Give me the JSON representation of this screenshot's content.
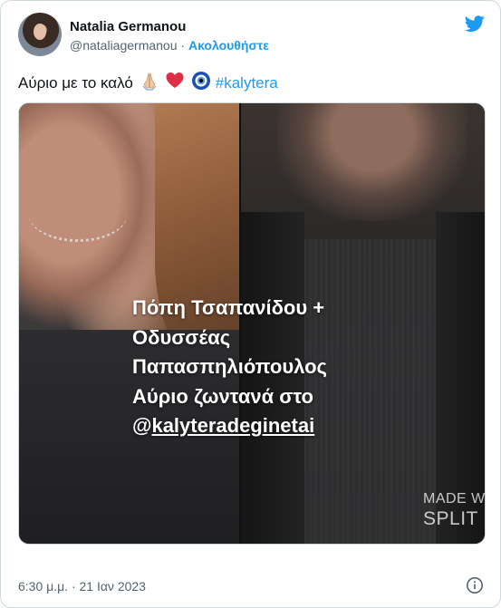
{
  "user": {
    "name": "Natalia Germanou",
    "handle": "@nataliagermanou",
    "separator": "·",
    "follow_label": "Ακολουθήστε"
  },
  "tweet": {
    "text": "Αύριο με το καλό",
    "emojis": [
      "folded-hands-icon",
      "red-heart-icon",
      "nazar-amulet-icon"
    ],
    "hashtag": "#kalytera"
  },
  "media": {
    "overlay_lines": [
      "Πόπη Τσαπανίδου +",
      "Οδυσσέας",
      "Παπασπηλιόπουλος",
      "Αύριο ζωντανά στο"
    ],
    "mention_at": "@",
    "mention_name": "kalyteradeginetai",
    "watermark_line1": "MADE W",
    "watermark_line2": "SPLIT P"
  },
  "footer": {
    "timestamp": "6:30 μ.μ. · 21 Ιαν 2023"
  },
  "colors": {
    "accent": "#1d9bf0",
    "text": "#0f1419",
    "muted": "#536471",
    "border": "#cfd9de"
  },
  "icons": {
    "brand": "twitter-bird-icon",
    "info": "info-icon"
  }
}
